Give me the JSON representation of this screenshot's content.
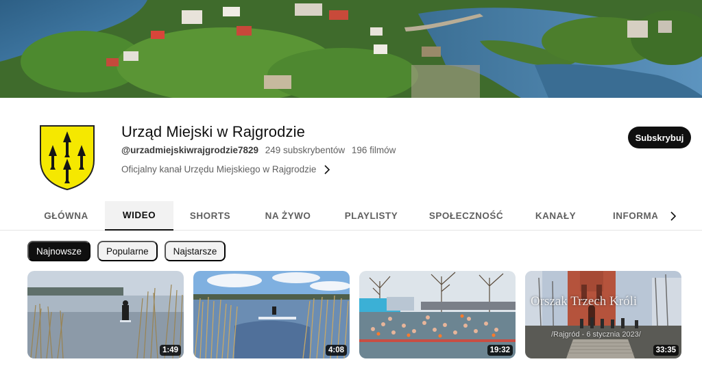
{
  "channel": {
    "name": "Urząd Miejski w Rajgrodzie",
    "handle": "@urzadmiejskiwrajgrodzie7829",
    "subscribers": "249 subskrybentów",
    "videos_count": "196 filmów",
    "description": "Oficjalny kanał Urzędu Miejskiego w Rajgrodzie",
    "subscribe_label": "Subskrybuj"
  },
  "tabs": [
    {
      "label": "GŁÓWNA",
      "active": false
    },
    {
      "label": "WIDEO",
      "active": true
    },
    {
      "label": "SHORTS",
      "active": false
    },
    {
      "label": "NA ŻYWO",
      "active": false
    },
    {
      "label": "PLAYLISTY",
      "active": false
    },
    {
      "label": "SPOŁECZNOŚĆ",
      "active": false
    },
    {
      "label": "KANAŁY",
      "active": false
    },
    {
      "label": "INFORMACJE",
      "active": false
    }
  ],
  "chips": [
    {
      "label": "Najnowsze",
      "active": true
    },
    {
      "label": "Popularne",
      "active": false
    },
    {
      "label": "Najstarsze",
      "active": false
    }
  ],
  "videos": [
    {
      "duration": "1:49"
    },
    {
      "duration": "4:08"
    },
    {
      "duration": "19:32"
    },
    {
      "duration": "33:35",
      "overlay_title": "Orszak Trzech Króli",
      "overlay_sub": "/Rajgród - 6 stycznia 2023/"
    }
  ],
  "colors": {
    "subscribe_bg": "#0f0f0f",
    "coat_of_arms": "#f5e800",
    "active_chip": "#0f0f0f"
  },
  "icons": {
    "description_more": "chevron-right-icon",
    "tabs_scroll": "chevron-right-icon"
  }
}
